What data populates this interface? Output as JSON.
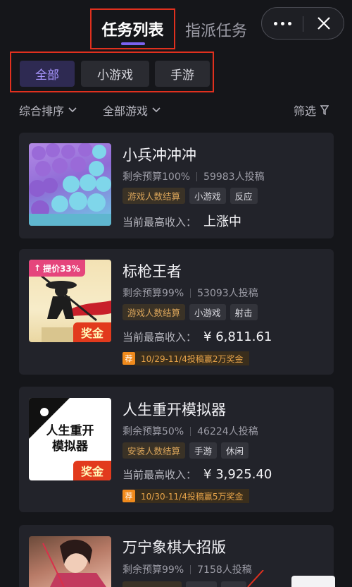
{
  "header": {
    "active_tab": "任务列表",
    "inactive_tab": "指派任务"
  },
  "filters": {
    "chips": [
      "全部",
      "小游戏",
      "手游"
    ]
  },
  "sort": {
    "sort_label": "综合排序",
    "game_label": "全部游戏",
    "filter_label": "筛选"
  },
  "cards": [
    {
      "title": "小兵冲冲冲",
      "budget": "剩余预算100%",
      "submissions": "59983人投稿",
      "tags": [
        "游戏人数结算",
        "小游戏",
        "反应"
      ],
      "income_label": "当前最高收入：",
      "income_value": "上涨中"
    },
    {
      "title": "标枪王者",
      "budget": "剩余预算99%",
      "submissions": "53093人投稿",
      "tags": [
        "游戏人数结算",
        "小游戏",
        "射击"
      ],
      "income_label": "当前最高收入：",
      "income_value": "¥ 6,811.61",
      "price_badge": "提价33%",
      "bonus_badge": "奖金",
      "promo_icon": "荐",
      "promo_text": "10/29-11/4投稿赢2万奖金"
    },
    {
      "title": "人生重开模拟器",
      "budget": "剩余预算50%",
      "submissions": "46224人投稿",
      "tags": [
        "安装人数结算",
        "手游",
        "休闲"
      ],
      "income_label": "当前最高收入：",
      "income_value": "¥ 3,925.40",
      "thumb_text_1": "人生重开",
      "thumb_text_2": "模拟器",
      "bonus_badge": "奖金",
      "promo_icon": "荐",
      "promo_text": "10/30-11/4投稿赢5万奖金"
    },
    {
      "title": "万宁象棋大招版",
      "budget": "剩余预算99%",
      "submissions": "7158人投稿"
    }
  ],
  "colors": {
    "accent": "#7a63f0",
    "annotation_red": "#e0301e",
    "gold": "#d9a45a"
  }
}
